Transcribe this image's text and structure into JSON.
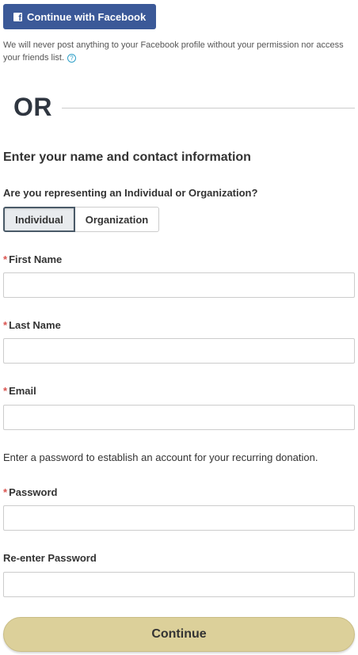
{
  "facebook": {
    "button_label": "Continue with Facebook",
    "icon": "facebook-icon",
    "note": "We will never post anything to your Facebook profile without your permission nor access your friends list.",
    "help_icon": "question-circle-icon",
    "help_glyph": "?"
  },
  "divider": {
    "label": "OR"
  },
  "form": {
    "section_title": "Enter your name and contact information",
    "type_question": "Are you representing an Individual or Organization?",
    "type_options": [
      {
        "label": "Individual",
        "selected": true
      },
      {
        "label": "Organization",
        "selected": false
      }
    ],
    "required_marker": "*",
    "fields": {
      "first_name": {
        "label": "First Name",
        "value": ""
      },
      "last_name": {
        "label": "Last Name",
        "value": ""
      },
      "email": {
        "label": "Email",
        "value": ""
      },
      "password": {
        "label": "Password",
        "value": ""
      },
      "reenter_password": {
        "label": "Re-enter Password",
        "value": ""
      }
    },
    "password_note": "Enter a password to establish an account for your recurring donation.",
    "submit_label": "Continue"
  },
  "colors": {
    "facebook_blue": "#3b5998",
    "required_red": "#d9534f",
    "continue_button": "#dcd09a",
    "help_icon_blue": "#2fa0c8"
  }
}
